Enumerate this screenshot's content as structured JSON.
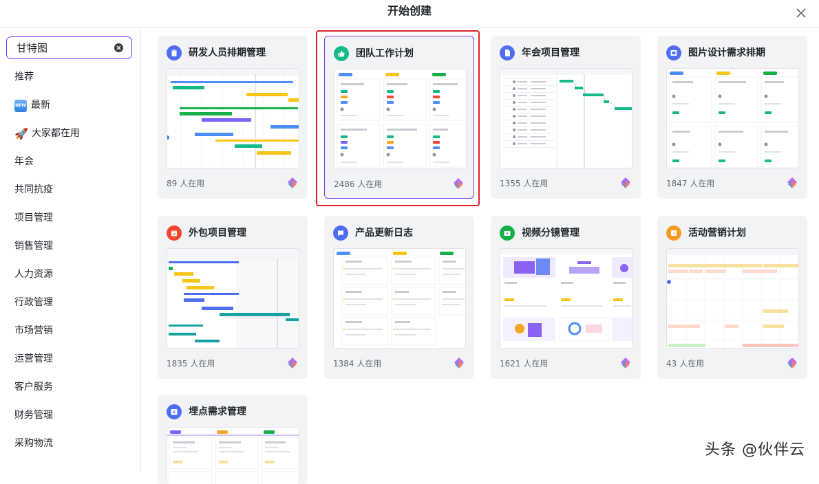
{
  "header": {
    "title": "开始创建"
  },
  "search": {
    "value": "甘特图"
  },
  "sidebar": {
    "items": [
      {
        "label": "推荐",
        "icon": ""
      },
      {
        "label": "最新",
        "icon": "new-badge-icon"
      },
      {
        "label": "大家都在用",
        "icon": "rocket-icon"
      },
      {
        "label": "年会",
        "icon": ""
      },
      {
        "label": "共同抗疫",
        "icon": ""
      },
      {
        "label": "项目管理",
        "icon": ""
      },
      {
        "label": "销售管理",
        "icon": ""
      },
      {
        "label": "人力资源",
        "icon": ""
      },
      {
        "label": "行政管理",
        "icon": ""
      },
      {
        "label": "市场营销",
        "icon": ""
      },
      {
        "label": "运营管理",
        "icon": ""
      },
      {
        "label": "客户服务",
        "icon": ""
      },
      {
        "label": "财务管理",
        "icon": ""
      },
      {
        "label": "采购物流",
        "icon": ""
      }
    ]
  },
  "new_badge": "NEW",
  "cards": [
    {
      "title": "研发人员排期管理",
      "usage": "89 人在用",
      "icon": "clipboard-icon",
      "color": "#4e6ef2"
    },
    {
      "title": "团队工作计划",
      "usage": "2486 人在用",
      "icon": "thumbs-up-icon",
      "color": "#15b98a"
    },
    {
      "title": "年会项目管理",
      "usage": "1355 人在用",
      "icon": "document-icon",
      "color": "#4e6ef2"
    },
    {
      "title": "图片设计需求排期",
      "usage": "1847 人在用",
      "icon": "image-icon",
      "color": "#4e6ef2"
    },
    {
      "title": "外包项目管理",
      "usage": "1835 人在用",
      "icon": "calendar-icon",
      "color": "#f2462e"
    },
    {
      "title": "产品更新日志",
      "usage": "1384 人在用",
      "icon": "chat-icon",
      "color": "#4e6ef2"
    },
    {
      "title": "视频分镜管理",
      "usage": "1621 人在用",
      "icon": "video-icon",
      "color": "#15b04a"
    },
    {
      "title": "活动营销计划",
      "usage": "43 人在用",
      "icon": "clock-icon",
      "color": "#f59a23"
    },
    {
      "title": "埋点需求管理",
      "usage": "",
      "icon": "download-box-icon",
      "color": "#4e6ef2"
    }
  ],
  "watermark": "头条 @伙伴云"
}
